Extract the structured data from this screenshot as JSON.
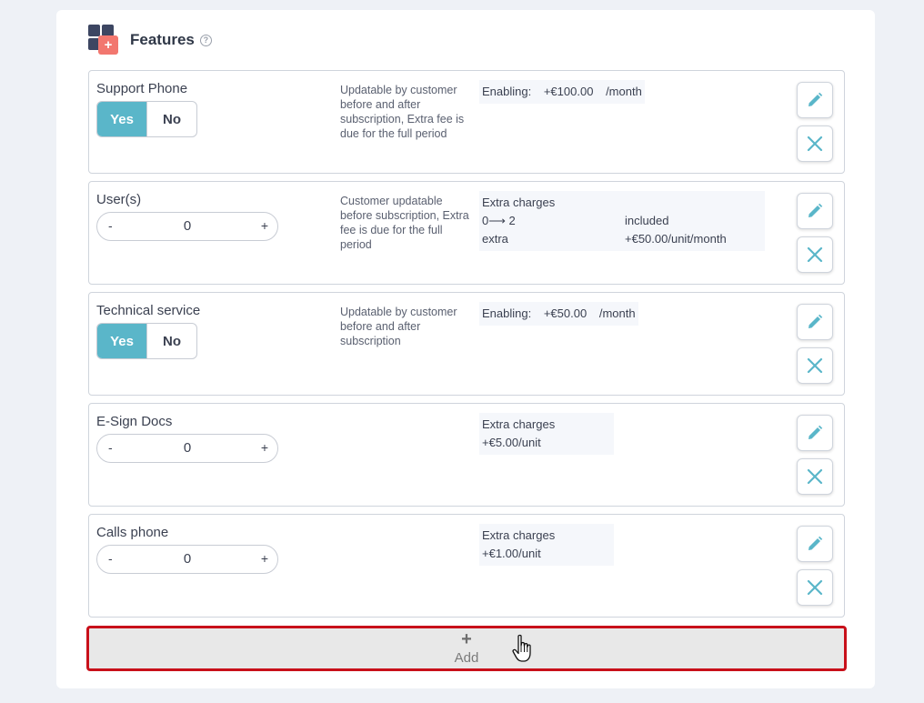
{
  "header": {
    "title": "Features",
    "help_icon": "help-circle-icon"
  },
  "colors": {
    "accent": "#5ab6c9",
    "highlight_border": "#c8101a",
    "logo_dark": "#3d4662",
    "logo_plus": "#f2776f"
  },
  "features": [
    {
      "name": "Support Phone",
      "control": "toggle",
      "toggle": {
        "yes": "Yes",
        "no": "No",
        "selected": "Yes"
      },
      "description": "Updatable by customer before and after subscription, Extra fee is due for the full period",
      "price": {
        "label": "Enabling:",
        "amount": "+€100.00",
        "period": "/month"
      }
    },
    {
      "name": "User(s)",
      "control": "stepper",
      "stepper": {
        "minus": "-",
        "value": "0",
        "plus": "+"
      },
      "description": "Customer updatable before subscription, Extra fee is due for the full period",
      "charges": {
        "title": "Extra charges",
        "rows": [
          {
            "range": "0⟶ 2",
            "price": "included"
          },
          {
            "range": "extra",
            "price": "+€50.00/unit/month"
          }
        ]
      }
    },
    {
      "name": "Technical service",
      "control": "toggle",
      "toggle": {
        "yes": "Yes",
        "no": "No",
        "selected": "Yes"
      },
      "description": "Updatable by customer before and after subscription",
      "price": {
        "label": "Enabling:",
        "amount": "+€50.00",
        "period": "/month"
      }
    },
    {
      "name": "E-Sign Docs",
      "control": "stepper",
      "stepper": {
        "minus": "-",
        "value": "0",
        "plus": "+"
      },
      "charges": {
        "title": "Extra charges",
        "unit_price": "+€5.00/unit"
      }
    },
    {
      "name": "Calls phone",
      "control": "stepper",
      "stepper": {
        "minus": "-",
        "value": "0",
        "plus": "+"
      },
      "charges": {
        "title": "Extra charges",
        "unit_price": "+€1.00/unit"
      }
    }
  ],
  "row_actions": {
    "edit_icon": "pencil-icon",
    "delete_icon": "close-icon"
  },
  "add_button": {
    "plus": "+",
    "label": "Add"
  }
}
